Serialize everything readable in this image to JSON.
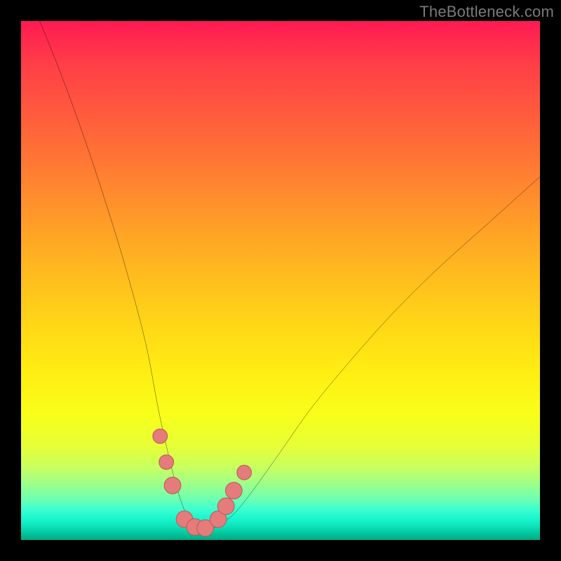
{
  "watermark": "TheBottleneck.com",
  "colors": {
    "curve": "#000000",
    "marker_fill": "#e47c7c",
    "marker_stroke": "#c25a5a",
    "background_top": "#ff1a53",
    "background_bottom": "#00aa82",
    "frame": "#000000"
  },
  "chart_data": {
    "type": "line",
    "title": "",
    "xlabel": "",
    "ylabel": "",
    "xlim": [
      0,
      100
    ],
    "ylim": [
      0,
      100
    ],
    "grid": false,
    "legend": false,
    "series": [
      {
        "name": "bottleneck-curve",
        "x": [
          0,
          4,
          8,
          12,
          16,
          20,
          24,
          26.5,
          29,
          31,
          33,
          35,
          37.5,
          41,
          45,
          50,
          56,
          63,
          71,
          80,
          90,
          100
        ],
        "values": [
          108,
          99,
          89,
          78,
          66,
          53,
          38,
          25,
          14,
          7,
          3,
          1.5,
          2.5,
          5,
          10,
          17,
          25.5,
          34,
          43,
          52,
          61,
          70
        ]
      }
    ],
    "markers": [
      {
        "name": "left-upper",
        "x": 26.8,
        "y": 20,
        "r": 1.4
      },
      {
        "name": "left-mid",
        "x": 28.0,
        "y": 15,
        "r": 1.4
      },
      {
        "name": "left-lower",
        "x": 29.2,
        "y": 10.5,
        "r": 1.6
      },
      {
        "name": "trough-a",
        "x": 31.5,
        "y": 4.0,
        "r": 1.6
      },
      {
        "name": "trough-b",
        "x": 33.5,
        "y": 2.5,
        "r": 1.6
      },
      {
        "name": "trough-c",
        "x": 35.5,
        "y": 2.3,
        "r": 1.6
      },
      {
        "name": "right-lower",
        "x": 38.0,
        "y": 4.0,
        "r": 1.6
      },
      {
        "name": "right-mid1",
        "x": 39.5,
        "y": 6.5,
        "r": 1.6
      },
      {
        "name": "right-mid2",
        "x": 41.0,
        "y": 9.5,
        "r": 1.6
      },
      {
        "name": "right-upper",
        "x": 43.0,
        "y": 13.0,
        "r": 1.4
      }
    ],
    "annotations": []
  }
}
